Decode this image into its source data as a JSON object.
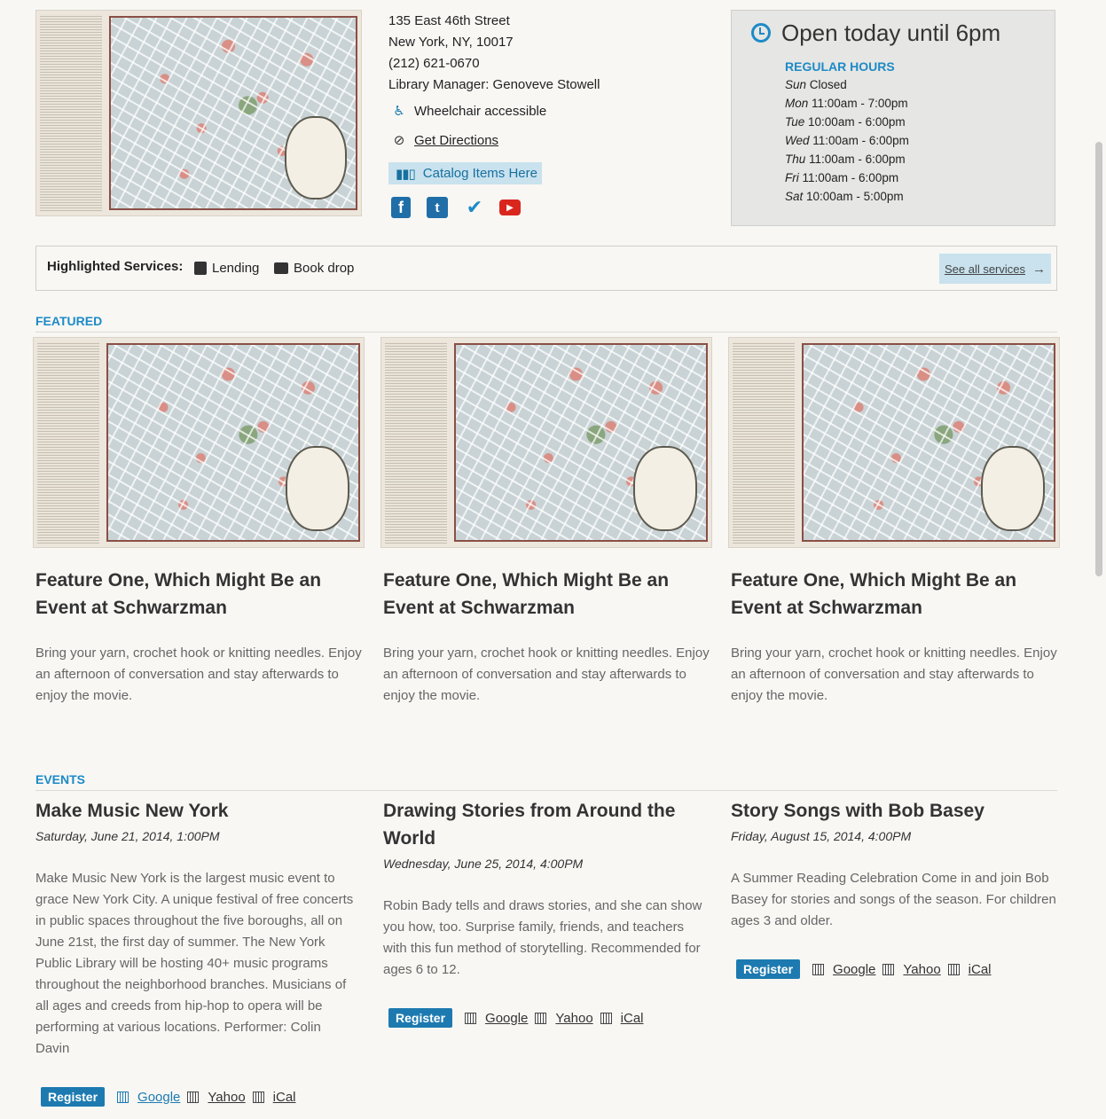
{
  "location": {
    "street": "135 East 46th Street",
    "city": "New York, NY, 10017",
    "phone": "(212) 621-0670",
    "manager": "Library Manager: Genoveve Stowell"
  },
  "amenities": {
    "wheelchair_label": "Wheelchair accessible",
    "wheelchair_icon": "wheelchair-icon",
    "directions_label": "Get Directions",
    "directions_icon": "directions-icon"
  },
  "catalog_button": {
    "label": "Catalog Items Here",
    "icon": "books-icon"
  },
  "social": [
    {
      "name": "facebook",
      "icon": "facebook-icon",
      "glyph": "f",
      "color": "#1f6ea8"
    },
    {
      "name": "twitter",
      "icon": "twitter-icon",
      "glyph": "t",
      "color": "#1f6ea8"
    },
    {
      "name": "foursquare",
      "icon": "checkin-icon",
      "glyph": "✔",
      "color": "#1d8ac7"
    },
    {
      "name": "youtube",
      "icon": "youtube-icon",
      "glyph": "▶",
      "color": "#d9271e"
    }
  ],
  "hours": {
    "status": "Open today until 6pm",
    "heading": "REGULAR HOURS",
    "days": [
      {
        "day": "Sun",
        "time": "Closed"
      },
      {
        "day": "Mon",
        "time": "11:00am - 7:00pm"
      },
      {
        "day": "Tue",
        "time": "10:00am - 6:00pm"
      },
      {
        "day": "Wed",
        "time": "11:00am - 6:00pm"
      },
      {
        "day": "Thu",
        "time": "11:00am - 6:00pm"
      },
      {
        "day": "Fri",
        "time": "11:00am - 6:00pm"
      },
      {
        "day": "Sat",
        "time": "10:00am - 5:00pm"
      }
    ]
  },
  "services": {
    "heading": "Highlighted Services:",
    "items": [
      {
        "label": "Lending",
        "icon": "book-icon"
      },
      {
        "label": "Book drop",
        "icon": "book-drop-icon"
      }
    ],
    "see_all": "See all services"
  },
  "featured": {
    "heading": "FEATURED",
    "items": [
      {
        "title": "Feature One, Which Might Be an Event at Schwarzman",
        "description": "Bring your yarn, crochet hook or knitting needles. Enjoy an afternoon of conversation and stay afterwards to enjoy the movie."
      },
      {
        "title": "Feature One, Which Might Be an Event at Schwarzman",
        "description": "Bring your yarn, crochet hook or knitting needles. Enjoy an afternoon of conversation and stay afterwards to enjoy the movie."
      },
      {
        "title": "Feature One, Which Might Be an Event at Schwarzman",
        "description": "Bring your yarn, crochet hook or knitting needles. Enjoy an afternoon of conversation and stay afterwards to enjoy the movie."
      }
    ]
  },
  "events": {
    "heading": "EVENTS",
    "items": [
      {
        "title": "Make Music New York",
        "date": "Saturday, June 21, 2014, 1:00PM",
        "description": "Make Music New York is the largest music event to grace New York City. A unique festival of free concerts in public spaces throughout the five boroughs, all on June 21st, the first day of summer. The New York Public Library will be hosting 40+ music programs throughout the neighborhood branches. Musicians of all ages and creeds from hip-hop to opera will be performing at various locations. Performer: Colin Davin",
        "register": "Register",
        "calendars": [
          "Google",
          "Yahoo",
          "iCal"
        ]
      },
      {
        "title": "Drawing Stories from Around the World",
        "date": "Wednesday, June 25, 2014, 4:00PM",
        "description": "Robin Bady tells and draws stories, and she can show you how, too. Surprise family, friends, and teachers with this fun method of storytelling. Recommended for ages 6 to 12.",
        "register": "Register",
        "calendars": [
          "Google",
          "Yahoo",
          "iCal"
        ]
      },
      {
        "title": "Story Songs with Bob Basey",
        "date": "Friday, August 15, 2014, 4:00PM",
        "description": "A Summer Reading Celebration Come in and join Bob Basey for stories and songs of the season. For children ages 3 and older.",
        "register": "Register",
        "calendars": [
          "Google",
          "Yahoo",
          "iCal"
        ]
      }
    ]
  }
}
